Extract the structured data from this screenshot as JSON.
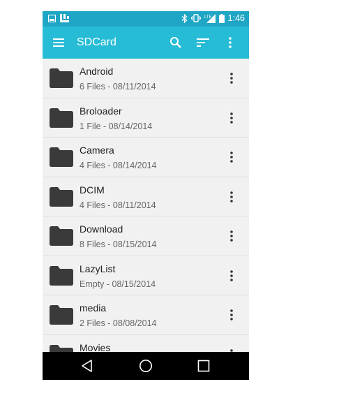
{
  "status_bar": {
    "time": "1:46",
    "icons": [
      "gallery-notification-icon",
      "app-notification-icon",
      "bluetooth-icon",
      "vibrate-icon",
      "lte-signal-icon",
      "battery-icon"
    ]
  },
  "app_bar": {
    "title": "SDCard",
    "background": "#27bcd6",
    "status_background": "#1fa6c4"
  },
  "files": [
    {
      "name": "Android",
      "meta": "6 Files - 08/11/2014"
    },
    {
      "name": "Broloader",
      "meta": "1 File - 08/14/2014"
    },
    {
      "name": "Camera",
      "meta": "4 Files - 08/14/2014"
    },
    {
      "name": "DCIM",
      "meta": "4 Files - 08/11/2014"
    },
    {
      "name": "Download",
      "meta": "8 Files - 08/15/2014"
    },
    {
      "name": "LazyList",
      "meta": "Empty - 08/15/2014"
    },
    {
      "name": "media",
      "meta": "2 Files - 08/08/2014"
    },
    {
      "name": "Movies",
      "meta": ""
    }
  ],
  "nav_bar": {
    "buttons": [
      "back-icon",
      "home-icon",
      "recents-icon"
    ]
  }
}
